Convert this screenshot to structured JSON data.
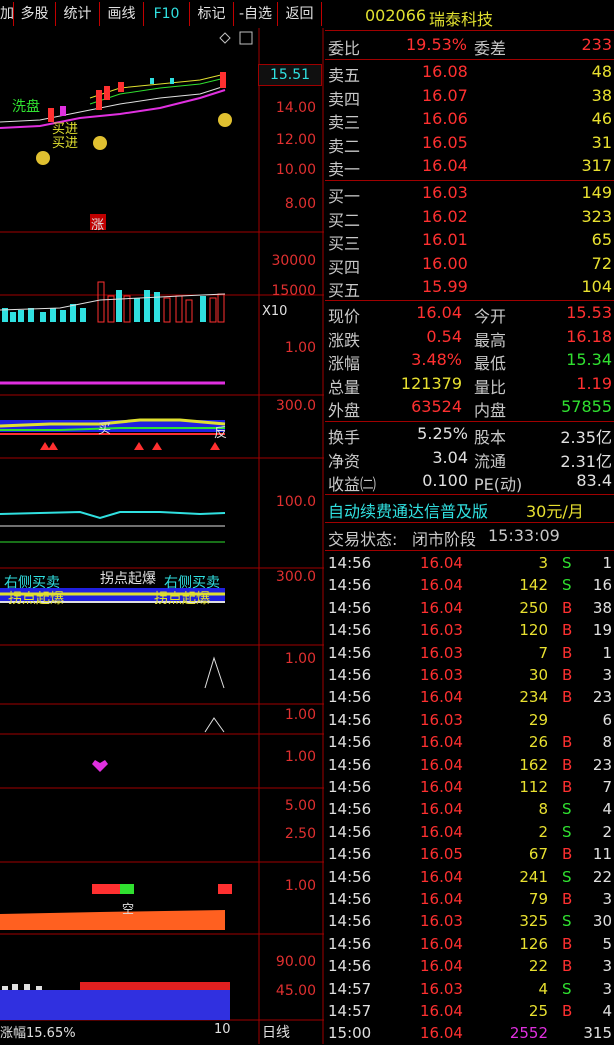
{
  "toolbar": {
    "buttons": [
      "加",
      "多股",
      "统计",
      "画线",
      "F10",
      "标记",
      "-自选",
      "返回"
    ]
  },
  "stock": {
    "code": "002066",
    "name": "瑞泰科技"
  },
  "chart": {
    "price_box": "15.51",
    "price_axis": [
      "14.00",
      "12.00",
      "10.00",
      "8.00"
    ],
    "vol_axis": [
      "30000",
      "15000",
      "X10"
    ],
    "axis_misc": [
      "1.00",
      "300.0",
      "100.0",
      "300.0",
      "1.00",
      "1.00",
      "1.00",
      "5.00",
      "2.50",
      "1.00",
      "90.00",
      "45.00"
    ],
    "signals": {
      "xipan": "洗盘",
      "maijin_a": "买进",
      "maijin_b": "买进",
      "zhang": "涨",
      "mai": "买",
      "fan": "反",
      "youce": "右侧买卖",
      "guaidian1": "拐点起爆",
      "guaidian_top": "拐点起爆",
      "youce2": "右侧买卖",
      "guaidian2": "拐点起爆",
      "kong": "空"
    },
    "bottom_label": "涨幅15.65%",
    "bottom_count": "10",
    "period": "日线"
  },
  "order_book": {
    "ratio_label": "委比",
    "ratio_value": "19.53%",
    "diff_label": "委差",
    "diff_value": "233",
    "asks": [
      {
        "label": "卖五",
        "price": "16.08",
        "vol": "48"
      },
      {
        "label": "卖四",
        "price": "16.07",
        "vol": "38"
      },
      {
        "label": "卖三",
        "price": "16.06",
        "vol": "46"
      },
      {
        "label": "卖二",
        "price": "16.05",
        "vol": "31"
      },
      {
        "label": "卖一",
        "price": "16.04",
        "vol": "317"
      }
    ],
    "bids": [
      {
        "label": "买一",
        "price": "16.03",
        "vol": "149"
      },
      {
        "label": "买二",
        "price": "16.02",
        "vol": "323"
      },
      {
        "label": "买三",
        "price": "16.01",
        "vol": "65"
      },
      {
        "label": "买四",
        "price": "16.00",
        "vol": "72"
      },
      {
        "label": "买五",
        "price": "15.99",
        "vol": "104"
      }
    ]
  },
  "quote": {
    "rows": [
      {
        "l1": "现价",
        "v1": "16.04",
        "c1": "red",
        "l2": "今开",
        "v2": "15.53",
        "c2": "red"
      },
      {
        "l1": "涨跌",
        "v1": "0.54",
        "c1": "red",
        "l2": "最高",
        "v2": "16.18",
        "c2": "red"
      },
      {
        "l1": "涨幅",
        "v1": "3.48%",
        "c1": "red",
        "l2": "最低",
        "v2": "15.34",
        "c2": "grn"
      },
      {
        "l1": "总量",
        "v1": "121379",
        "c1": "yel",
        "l2": "量比",
        "v2": "1.19",
        "c2": "red"
      },
      {
        "l1": "外盘",
        "v1": "63524",
        "c1": "red",
        "l2": "内盘",
        "v2": "57855",
        "c2": "grn"
      }
    ],
    "rows2": [
      {
        "l1": "换手",
        "v1": "5.25%",
        "l2": "股本",
        "v2": "2.35亿"
      },
      {
        "l1": "净资",
        "v1": "3.04",
        "l2": "流通",
        "v2": "2.31亿"
      },
      {
        "l1": "收益㈡",
        "v1": "0.100",
        "l2": "PE(动)",
        "v2": "83.4"
      }
    ]
  },
  "ad": {
    "text": "自动续费通达信普及版",
    "price": "30元/月"
  },
  "trade_status": {
    "label": "交易状态:",
    "phase": "闭市阶段",
    "time": "15:33:09"
  },
  "ticks": [
    {
      "t": "14:56",
      "p": "16.04",
      "pc": "red",
      "v": "3",
      "s": "S",
      "n": "1"
    },
    {
      "t": "14:56",
      "p": "16.04",
      "pc": "red",
      "v": "142",
      "s": "S",
      "n": "16"
    },
    {
      "t": "14:56",
      "p": "16.04",
      "pc": "red",
      "v": "250",
      "s": "B",
      "n": "38"
    },
    {
      "t": "14:56",
      "p": "16.03",
      "pc": "red",
      "v": "120",
      "s": "B",
      "n": "19"
    },
    {
      "t": "14:56",
      "p": "16.03",
      "pc": "red",
      "v": "7",
      "s": "B",
      "n": "1"
    },
    {
      "t": "14:56",
      "p": "16.03",
      "pc": "red",
      "v": "30",
      "s": "B",
      "n": "3"
    },
    {
      "t": "14:56",
      "p": "16.04",
      "pc": "red",
      "v": "234",
      "s": "B",
      "n": "23"
    },
    {
      "t": "14:56",
      "p": "16.03",
      "pc": "red",
      "v": "29",
      "s": "",
      "n": "6"
    },
    {
      "t": "14:56",
      "p": "16.04",
      "pc": "red",
      "v": "26",
      "s": "B",
      "n": "8"
    },
    {
      "t": "14:56",
      "p": "16.04",
      "pc": "red",
      "v": "162",
      "s": "B",
      "n": "23"
    },
    {
      "t": "14:56",
      "p": "16.04",
      "pc": "red",
      "v": "112",
      "s": "B",
      "n": "7"
    },
    {
      "t": "14:56",
      "p": "16.04",
      "pc": "red",
      "v": "8",
      "s": "S",
      "n": "4"
    },
    {
      "t": "14:56",
      "p": "16.04",
      "pc": "red",
      "v": "2",
      "s": "S",
      "n": "2"
    },
    {
      "t": "14:56",
      "p": "16.05",
      "pc": "red",
      "v": "67",
      "s": "B",
      "n": "11"
    },
    {
      "t": "14:56",
      "p": "16.04",
      "pc": "red",
      "v": "241",
      "s": "S",
      "n": "22"
    },
    {
      "t": "14:56",
      "p": "16.04",
      "pc": "red",
      "v": "79",
      "s": "B",
      "n": "3"
    },
    {
      "t": "14:56",
      "p": "16.03",
      "pc": "red",
      "v": "325",
      "s": "S",
      "n": "30"
    },
    {
      "t": "14:56",
      "p": "16.04",
      "pc": "red",
      "v": "126",
      "s": "B",
      "n": "5"
    },
    {
      "t": "14:56",
      "p": "16.04",
      "pc": "red",
      "v": "22",
      "s": "B",
      "n": "3"
    },
    {
      "t": "14:57",
      "p": "16.03",
      "pc": "red",
      "v": "4",
      "s": "S",
      "n": "3"
    },
    {
      "t": "14:57",
      "p": "16.04",
      "pc": "red",
      "v": "25",
      "s": "B",
      "n": "4"
    },
    {
      "t": "15:00",
      "p": "16.04",
      "pc": "red",
      "v": "2552",
      "s": "",
      "n": "315"
    }
  ]
}
